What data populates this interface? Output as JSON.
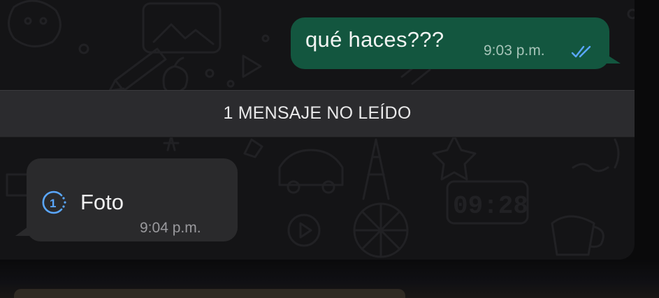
{
  "outgoing_message": {
    "text": "qué haces???",
    "time": "9:03 p.m.",
    "status_icon": "double-check-read-icon",
    "bubble_color": "#13563f",
    "tick_color": "#5aa7ff"
  },
  "unread_divider": {
    "label": "1 MENSAJE NO LEÍDO"
  },
  "incoming_message": {
    "icon": "view-once-icon",
    "icon_digit": "1",
    "text": "Foto",
    "time": "9:04 p.m.",
    "bubble_color": "#2a2a2c",
    "icon_color": "#5aa7ff"
  },
  "wallpaper": {
    "background": "#141416",
    "doodle_color": "#2c2c30",
    "clock_doodle_text": "09:28"
  }
}
